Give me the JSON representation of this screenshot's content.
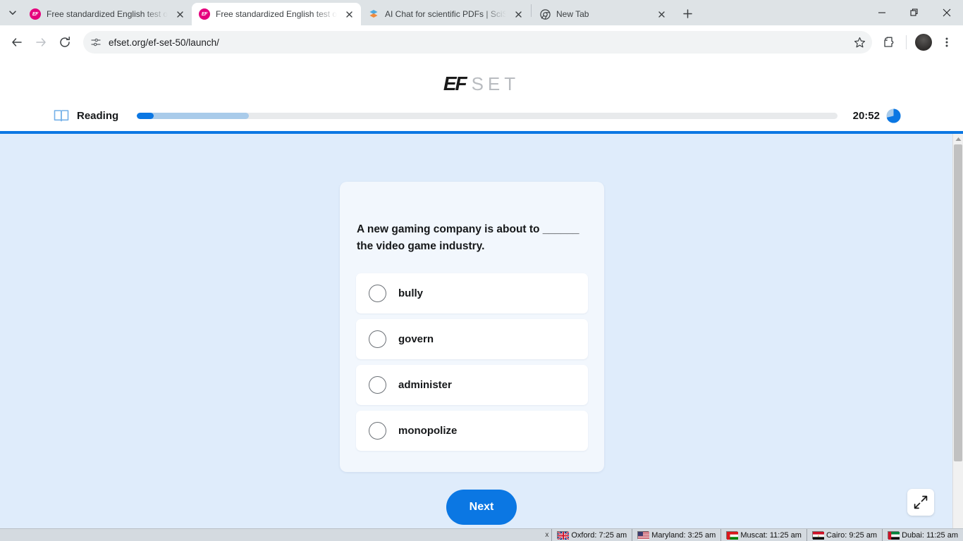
{
  "browser": {
    "tabs": [
      {
        "title": "Free standardized English test o",
        "favicon": "ef-icon",
        "active": false
      },
      {
        "title": "Free standardized English test o",
        "favicon": "ef-icon",
        "active": true
      },
      {
        "title": "AI Chat for scientific PDFs | SciS",
        "favicon": "scispace-icon",
        "active": false
      },
      {
        "title": "New Tab",
        "favicon": "chrome-icon",
        "active": false
      }
    ],
    "url": "efset.org/ef-set-50/launch/",
    "new_tab_label": "+",
    "window_controls": {
      "minimize": "minimize-icon",
      "maximize": "restore-icon",
      "close": "close-icon"
    }
  },
  "page": {
    "logo": {
      "mark": "EF",
      "word": "SET"
    },
    "progress": {
      "skill_label": "Reading",
      "skill_icon": "book-icon",
      "fill_percent": 2,
      "mid_percent": 16,
      "accent_color": "#0b77e3",
      "mid_color": "#a9cbea",
      "track_color": "#e8eaec"
    },
    "timer": {
      "time": "20:52",
      "icon": "pie-timer-icon"
    },
    "question": {
      "text": "A new gaming company is about to ______ the video game industry.",
      "options": [
        {
          "label": "bully",
          "selected": false
        },
        {
          "label": "govern",
          "selected": false
        },
        {
          "label": "administer",
          "selected": false
        },
        {
          "label": "monopolize",
          "selected": false
        }
      ]
    },
    "next_button": "Next",
    "fullscreen_button_icon": "expand-icon",
    "background_color": "#dfecfb",
    "card_color": "#f2f7fd"
  },
  "taskbar": {
    "close_label": "x",
    "clocks": [
      {
        "city": "Oxford",
        "time": "7:25 am",
        "flag": "uk-flag"
      },
      {
        "city": "Maryland",
        "time": "3:25 am",
        "flag": "us-flag"
      },
      {
        "city": "Muscat",
        "time": "11:25 am",
        "flag": "oman-flag"
      },
      {
        "city": "Cairo",
        "time": "9:25 am",
        "flag": "egypt-flag"
      },
      {
        "city": "Dubai",
        "time": "11:25 am",
        "flag": "uae-flag"
      }
    ]
  }
}
